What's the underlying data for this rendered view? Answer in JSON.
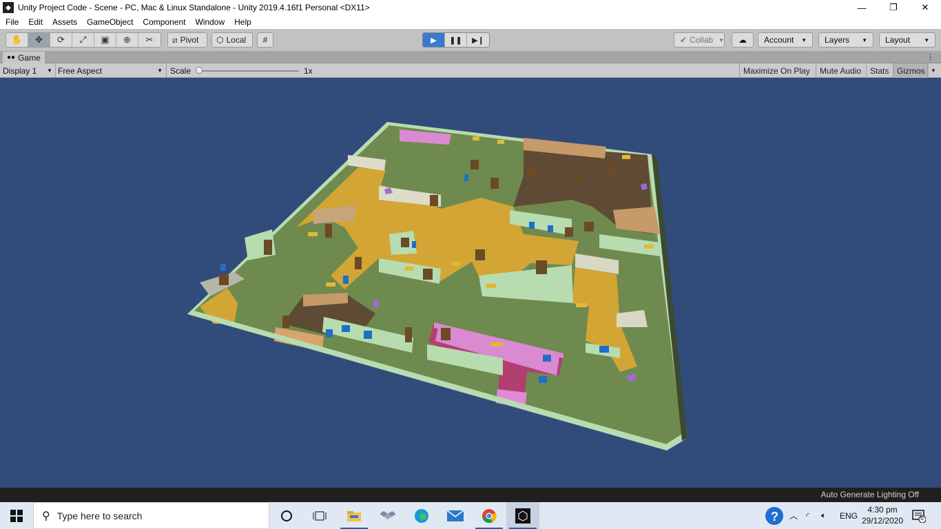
{
  "window": {
    "title": "Unity Project Code - Scene - PC, Mac & Linux Standalone - Unity 2019.4.16f1 Personal <DX11>",
    "minimize_glyph": "—",
    "maximize_glyph": "❐",
    "close_glyph": "✕"
  },
  "menu": [
    "File",
    "Edit",
    "Assets",
    "GameObject",
    "Component",
    "Window",
    "Help"
  ],
  "toolbar": {
    "pivot_label": "Pivot",
    "local_label": "Local",
    "collab_label": "Collab",
    "account_label": "Account",
    "layers_label": "Layers",
    "layout_label": "Layout"
  },
  "game_tab": {
    "label": "Game",
    "display_label": "Display 1",
    "aspect_label": "Free Aspect",
    "scale_label": "Scale",
    "scale_value": "1x",
    "maximize_label": "Maximize On Play",
    "mute_label": "Mute Audio",
    "stats_label": "Stats",
    "gizmos_label": "Gizmos"
  },
  "status": {
    "message": "Auto Generate Lighting Off"
  },
  "taskbar": {
    "search_placeholder": "Type here to search",
    "language": "ENG",
    "time": "4:30 pm",
    "date": "29/12/2020",
    "notification_count": "6"
  },
  "colors": {
    "viewport_bg": "#314c7b",
    "floor_green": "#6f8a4e",
    "floor_yellow": "#d3a534",
    "floor_brown": "#5f4a35",
    "wall_mint": "#b7dcb0",
    "wall_pink": "#d98ad0",
    "wall_tan": "#c79a6a",
    "door_brown": "#6b4a26",
    "window_blue": "#1f6fc9"
  }
}
